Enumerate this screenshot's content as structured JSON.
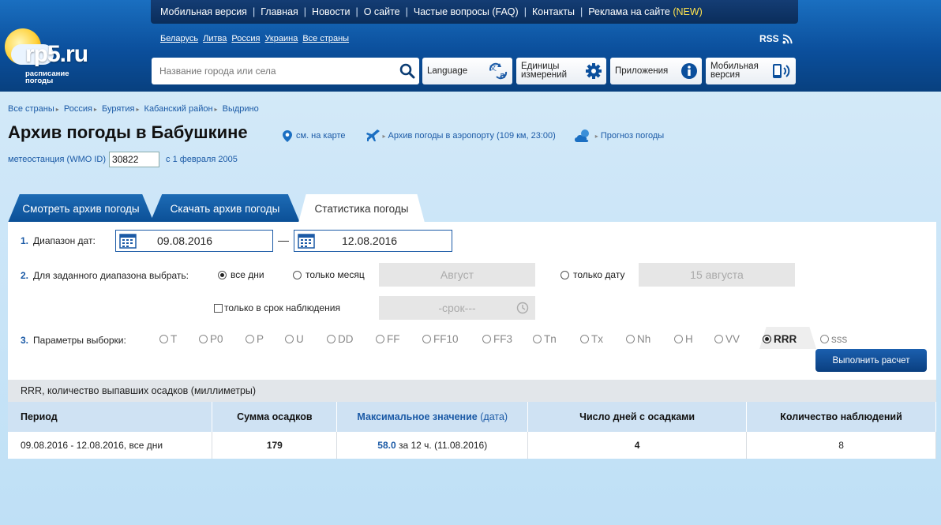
{
  "header": {
    "top_links": [
      "Мобильная версия",
      "Главная",
      "Новости",
      "О сайте",
      "Частые вопросы (FAQ)",
      "Контакты",
      "Реклама на сайте"
    ],
    "top_new": "(NEW)",
    "logo_text": "rp5.ru",
    "logo_sub1": "расписание",
    "logo_sub2": "погоды",
    "countries": [
      "Беларусь",
      "Литва",
      "Россия",
      "Украина",
      "Все страны"
    ],
    "rss": "RSS",
    "search_placeholder": "Название города или села",
    "language": "Language",
    "units_1": "Единицы",
    "units_2": "измерений",
    "apps": "Приложения",
    "mobile_1": "Мобильная",
    "mobile_2": "версия"
  },
  "breadcrumb": [
    "Все страны",
    "Россия",
    "Бурятия",
    "Кабанский район",
    "Выдрино"
  ],
  "page": {
    "title": "Архив погоды в Бабушкине",
    "map_link": "см. на карте",
    "airport_link": "Архив погоды в аэропорту (109 км, 23:00)",
    "forecast_link": "Прогноз погоды",
    "station_label": "метеостанция (WMO ID)",
    "station_id": "30822",
    "since": "с 1 февраля 2005"
  },
  "tabs": [
    "Смотреть архив погоды",
    "Скачать архив погоды",
    "Статистика погоды"
  ],
  "form": {
    "step1_num": "1.",
    "step1_label": "Диапазон дат:",
    "date_from": "09.08.2016",
    "dash": "—",
    "date_to": "12.08.2016",
    "step2_num": "2.",
    "step2_label": "Для заданного диапазона выбрать:",
    "opt_all": "все дни",
    "opt_month": "только месяц",
    "month_value": "Август",
    "opt_date": "только дату",
    "date_value": "15 августа",
    "obs_label": "только в срок наблюдения",
    "term_value": "-срок---",
    "step3_num": "3.",
    "step3_label": "Параметры выборки:",
    "params": [
      "T",
      "P0",
      "P",
      "U",
      "DD",
      "FF",
      "FF10",
      "FF3",
      "Tn",
      "Tx",
      "Nh",
      "H",
      "VV",
      "RRR",
      "sss"
    ],
    "selected_param": "RRR",
    "calc_button": "Выполнить расчет"
  },
  "result": {
    "caption": "RRR, количество выпавших осадков (миллиметры)",
    "headers": {
      "period": "Период",
      "sum": "Сумма осадков",
      "max": "Максимальное значение",
      "max_paren": "(дата)",
      "days": "Число дней с осадками",
      "count": "Количество наблюдений"
    },
    "row": {
      "period": "09.08.2016 - 12.08.2016, все дни",
      "sum": "179",
      "max_value": "58.0",
      "max_rest": " за 12 ч. (11.08.2016)",
      "days": "4",
      "count": "8"
    }
  },
  "colors": {
    "header_blue": "#0b4f9c",
    "link_blue": "#1b5aa6",
    "new_yellow": "#ffe34d",
    "table_header": "#cfe2f3"
  }
}
